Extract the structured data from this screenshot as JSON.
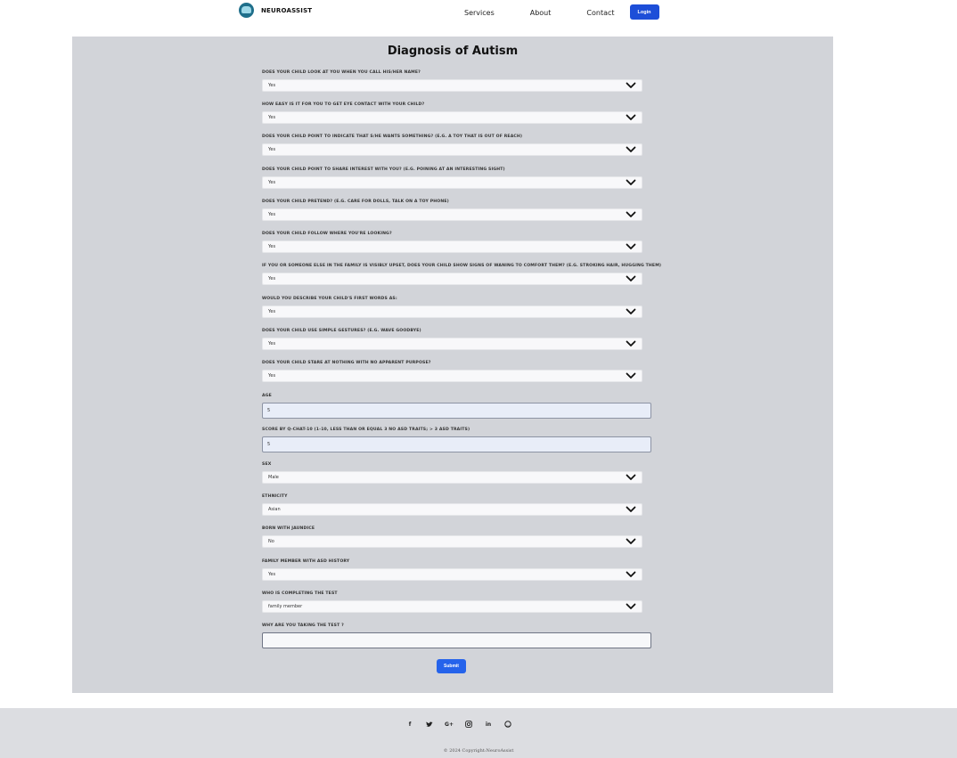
{
  "nav": {
    "brand": "NEUROASSIST",
    "links": [
      "Services",
      "About",
      "Contact"
    ],
    "login_label": "Login"
  },
  "form": {
    "title": "Diagnosis of Autism",
    "questions": [
      {
        "label": "DOES YOUR CHILD LOOK AT YOU WHEN YOU CALL HIS/HER NAME?",
        "value": "Yes"
      },
      {
        "label": "HOW EASY IS IT FOR YOU TO GET EYE CONTACT WITH YOUR CHILD?",
        "value": "Yes"
      },
      {
        "label": "DOES YOUR CHILD POINT TO INDICATE THAT S/HE WANTS SOMETHING? (E.G. A TOY THAT IS OUT OF REACH)",
        "value": "Yes"
      },
      {
        "label": "DOES YOUR CHILD POINT TO SHARE INTEREST WITH YOU? (E.G. POINING AT AN INTERESTING SIGHT)",
        "value": "Yes"
      },
      {
        "label": "DOES YOUR CHILD PRETEND? (E.G. CARE FOR DOLLS, TALK ON A TOY PHONE)",
        "value": "Yes"
      },
      {
        "label": "DOES YOUR CHILD FOLLOW WHERE YOU'RE LOOKING?",
        "value": "Yes"
      },
      {
        "label": "IF YOU OR SOMEONE ELSE IN THE FAMILY IS VISIBLY UPSET, DOES YOUR CHILD SHOW SIGNS OF WANING TO COMFORT THEM? (E.G. STROKING HAIR, HUGGING THEM)",
        "value": "Yes"
      },
      {
        "label": "WOULD YOU DESCRIBE YOUR CHILD'S FIRST WORDS AS:",
        "value": "Yes"
      },
      {
        "label": "DOES YOUR CHILD USE SIMPLE GESTURES? (E.G. WAVE GOODBYE)",
        "value": "Yes"
      },
      {
        "label": "DOES YOUR CHILD STARE AT NOTHING WITH NO APPARENT PURPOSE?",
        "value": "Yes"
      }
    ],
    "age": {
      "label": "AGE",
      "value": "5"
    },
    "score": {
      "label": "SCORE BY Q-CHAT-10 (1-10, LESS THAN OR EQUAL 3 NO ASD TRAITS; > 3 ASD TRAITS)",
      "value": "5"
    },
    "sex": {
      "label": "SEX",
      "value": "Male"
    },
    "ethnicity": {
      "label": "ETHNICITY",
      "value": "Asian"
    },
    "jaundice": {
      "label": "BORN WITH JAUNDICE",
      "value": "No"
    },
    "family_history": {
      "label": "FAMILY MEMBER WITH ASD HISTORY",
      "value": "Yes"
    },
    "completer": {
      "label": "WHO IS COMPLETING THE TEST",
      "value": "family member"
    },
    "reason": {
      "label": "WHY ARE YOU TAKING THE TEST ?",
      "value": ""
    },
    "submit_label": "Submit"
  },
  "footer": {
    "socials": [
      "facebook-icon",
      "twitter-icon",
      "google-plus-icon",
      "instagram-icon",
      "linkedin-icon",
      "github-icon"
    ],
    "social_glyphs": [
      "f",
      "🐦",
      "G+",
      "◎",
      "in",
      "◯"
    ],
    "copyright": "© 2024 Copyright:NeuroAssist"
  },
  "colors": {
    "panel": "#d2d4d9",
    "accent": "#1d4ed8",
    "submit": "#2563eb",
    "footer": "#dcdde1"
  }
}
